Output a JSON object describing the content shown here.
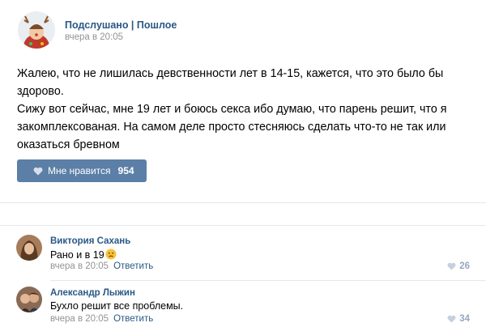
{
  "post": {
    "author": "Подслушано | Пошлое",
    "date": "вчера в 20:05",
    "paragraphs": [
      "Жалею, что не лишилась девственности лет в 14-15, кажется, что это было бы здорово.",
      "Сижу вот сейчас, мне 19 лет и боюсь секса ибо думаю, что парень решит, что я закомплексованая. На самом деле просто стесняюсь сделать что-то не так или оказаться бревном"
    ],
    "like_label": "Мне нравится",
    "like_count": "954",
    "avatar_icon": "reindeer-costume-avatar"
  },
  "comments": [
    {
      "author": "Виктория Сахань",
      "text": "Рано и в 19",
      "emoji": "sad-face-emoji",
      "date": "вчера в 20:05",
      "reply_label": "Ответить",
      "likes": "26"
    },
    {
      "author": "Александр Лыжин",
      "text": "Бухло решит все проблемы.",
      "date": "вчера в 20:05",
      "reply_label": "Ответить",
      "likes": "34"
    }
  ],
  "colors": {
    "link": "#2a5885",
    "muted": "#939393",
    "button": "#5b7fa6",
    "like_muted": "#94a8c3"
  }
}
